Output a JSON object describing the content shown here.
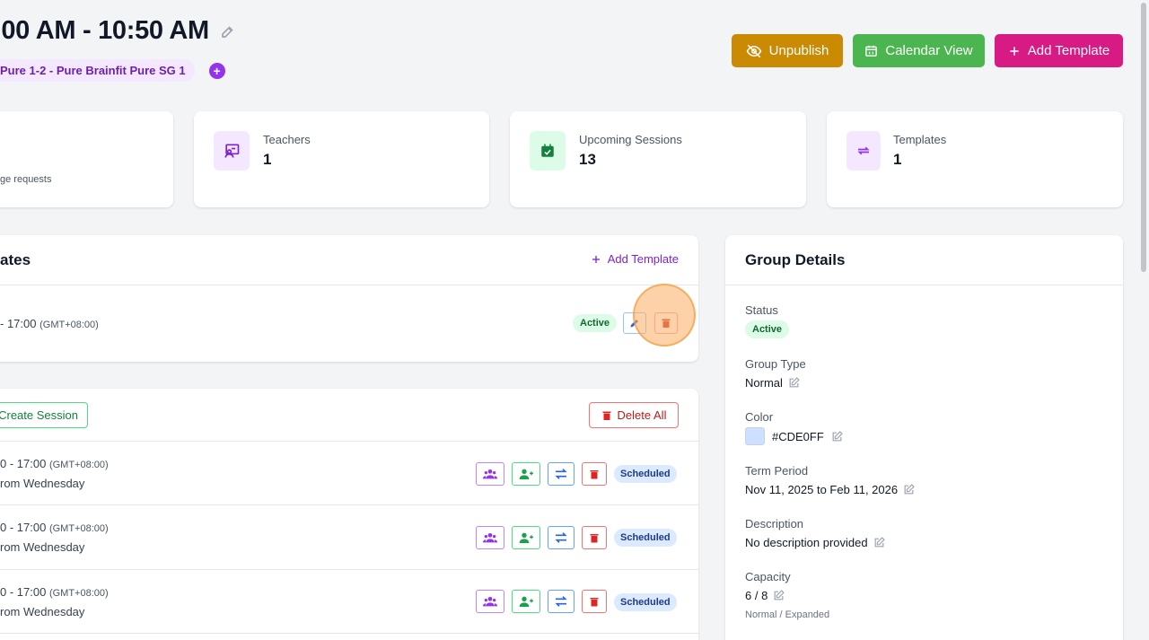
{
  "header": {
    "title": ":00 AM - 10:50 AM",
    "group_pill": "Pure 1-2 - Pure Brainfit Pure SG 1",
    "buttons": {
      "unpublish": "Unpublish",
      "calendar_view": "Calendar View",
      "add_template": "Add Template"
    }
  },
  "stats": [
    {
      "sub": "ge requests"
    },
    {
      "label": "Teachers",
      "value": "1",
      "icon": "teacher-icon"
    },
    {
      "label": "Upcoming Sessions",
      "value": "13",
      "icon": "calendar-check-icon"
    },
    {
      "label": "Templates",
      "value": "1",
      "icon": "repeat-icon"
    }
  ],
  "templates": {
    "title": "ates",
    "add_template": "Add Template",
    "row": {
      "time": "- 17:00",
      "tz": "(GMT+08:00)",
      "status": "Active"
    }
  },
  "sessions": {
    "create_session": "Create Session",
    "delete_all": "Delete All",
    "rows": [
      {
        "time": "0 - 17:00",
        "tz": "(GMT+08:00)",
        "from": "rom Wednesday",
        "status": "Scheduled"
      },
      {
        "time": "0 - 17:00",
        "tz": "(GMT+08:00)",
        "from": "rom Wednesday",
        "status": "Scheduled"
      },
      {
        "time": "0 - 17:00",
        "tz": "(GMT+08:00)",
        "from": "rom Wednesday",
        "status": "Scheduled"
      }
    ]
  },
  "group_details": {
    "title": "Group Details",
    "status_label": "Status",
    "status_value": "Active",
    "type_label": "Group Type",
    "type_value": "Normal",
    "color_label": "Color",
    "color_value": "#CDE0FF",
    "term_label": "Term Period",
    "term_value": "Nov 11, 2025 to Feb 11, 2026",
    "desc_label": "Description",
    "desc_value": "No description provided",
    "capacity_label": "Capacity",
    "capacity_value": "6 / 8",
    "capacity_note": "Normal / Expanded"
  },
  "colors": {
    "unpublish": "#ca8a04",
    "calendar": "#4bb54f",
    "add_template": "#d81b84",
    "accent_purple": "#9333ea",
    "swatch": "#CDE0FF"
  }
}
